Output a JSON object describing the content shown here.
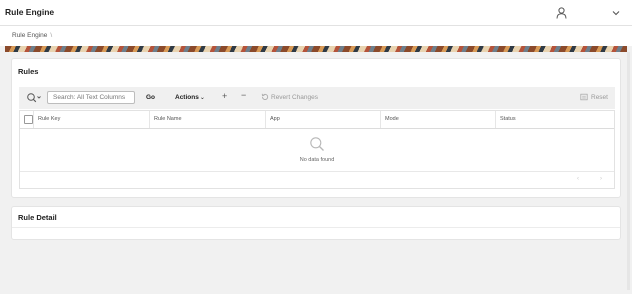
{
  "app": {
    "title": "Rule Engine"
  },
  "header": {
    "user_icon": "user-icon",
    "menu_icon": "chevron-down-icon"
  },
  "breadcrumb": {
    "items": [
      "Rule Engine"
    ],
    "separator": "\\"
  },
  "rules_region": {
    "title": "Rules",
    "toolbar": {
      "search_placeholder": "Search: All Text Columns",
      "go_label": "Go",
      "actions_label": "Actions",
      "add_label": "+",
      "remove_label": "−",
      "revert_label": "Revert Changes",
      "reset_label": "Reset"
    },
    "columns": [
      "Rule Key",
      "Rule Name",
      "App",
      "Mode",
      "Status"
    ],
    "rows": [],
    "no_data_text": "No data found",
    "pager": {
      "prev": "‹",
      "next": "›"
    }
  },
  "detail_region": {
    "title": "Rule Detail"
  },
  "colors": {
    "background": "#f1f1f1",
    "panel": "#ffffff",
    "toolbar": "#f0f0f0",
    "text": "#222222",
    "muted": "#999999"
  }
}
